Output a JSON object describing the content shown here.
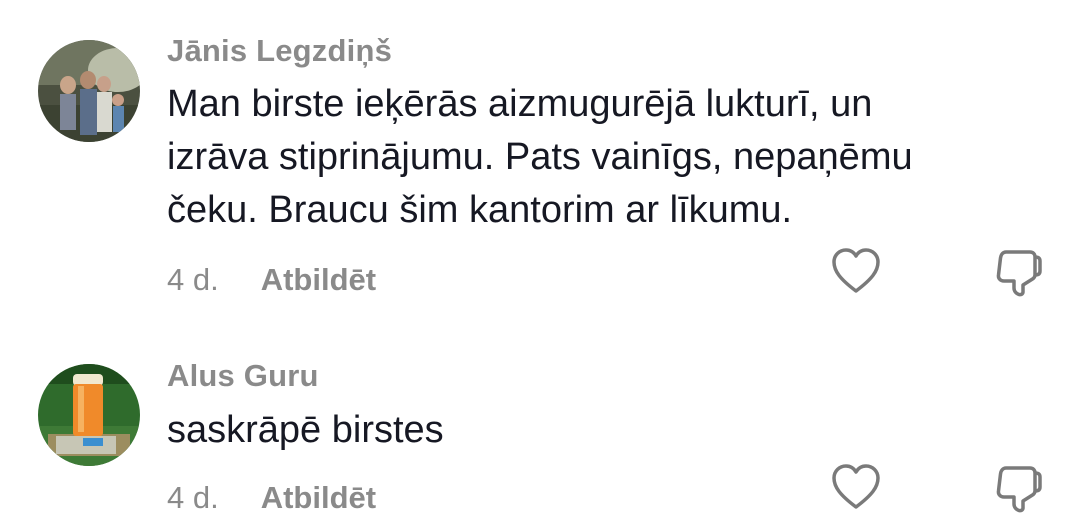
{
  "comments": [
    {
      "author": "Jānis Legzdiņš",
      "text": "Man birste ieķērās aizmugurējā lukturī, un\nizrāva stiprinājumu. Pats vainīgs, nepaņēmu\nčeku. Braucu šim kantorim ar līkumu.",
      "time": "4 d.",
      "reply_label": "Atbildēt",
      "avatar_icon": "family-photo-avatar",
      "like_icon": "heart-icon",
      "dislike_icon": "thumbs-down-icon"
    },
    {
      "author": "Alus Guru",
      "text": "saskrāpē birstes",
      "time": "4 d.",
      "reply_label": "Atbildēt",
      "avatar_icon": "beer-glass-avatar",
      "like_icon": "heart-icon",
      "dislike_icon": "thumbs-down-icon"
    }
  ],
  "colors": {
    "author": "#8a8a8a",
    "text": "#161823",
    "meta": "#8a8a8a",
    "icon": "#7a7a7a"
  }
}
